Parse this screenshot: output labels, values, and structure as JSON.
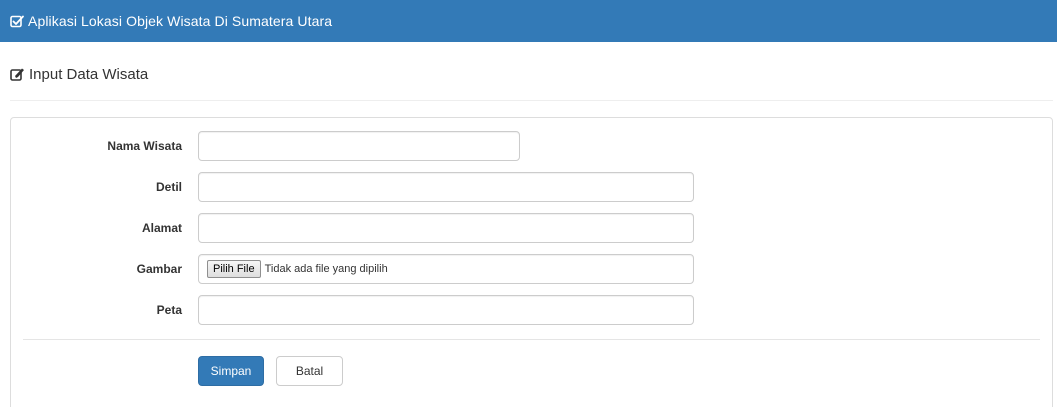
{
  "header": {
    "title": "Aplikasi Lokasi Objek Wisata Di Sumatera Utara",
    "icon": "checkbox-edit-icon",
    "bg_color": "#337ab7"
  },
  "page": {
    "heading": "Input Data Wisata",
    "icon": "edit-icon"
  },
  "form": {
    "fields": [
      {
        "label": "Nama Wisata",
        "value": "",
        "placeholder": ""
      },
      {
        "label": "Detil",
        "value": "",
        "placeholder": ""
      },
      {
        "label": "Alamat",
        "value": "",
        "placeholder": ""
      },
      {
        "label": "Gambar",
        "file_button": "Pilih File",
        "file_status": "Tidak ada file yang dipilih"
      },
      {
        "label": "Peta",
        "value": "",
        "placeholder": ""
      }
    ],
    "submit_label": "Simpan",
    "cancel_label": "Batal",
    "primary_color": "#337ab7"
  }
}
